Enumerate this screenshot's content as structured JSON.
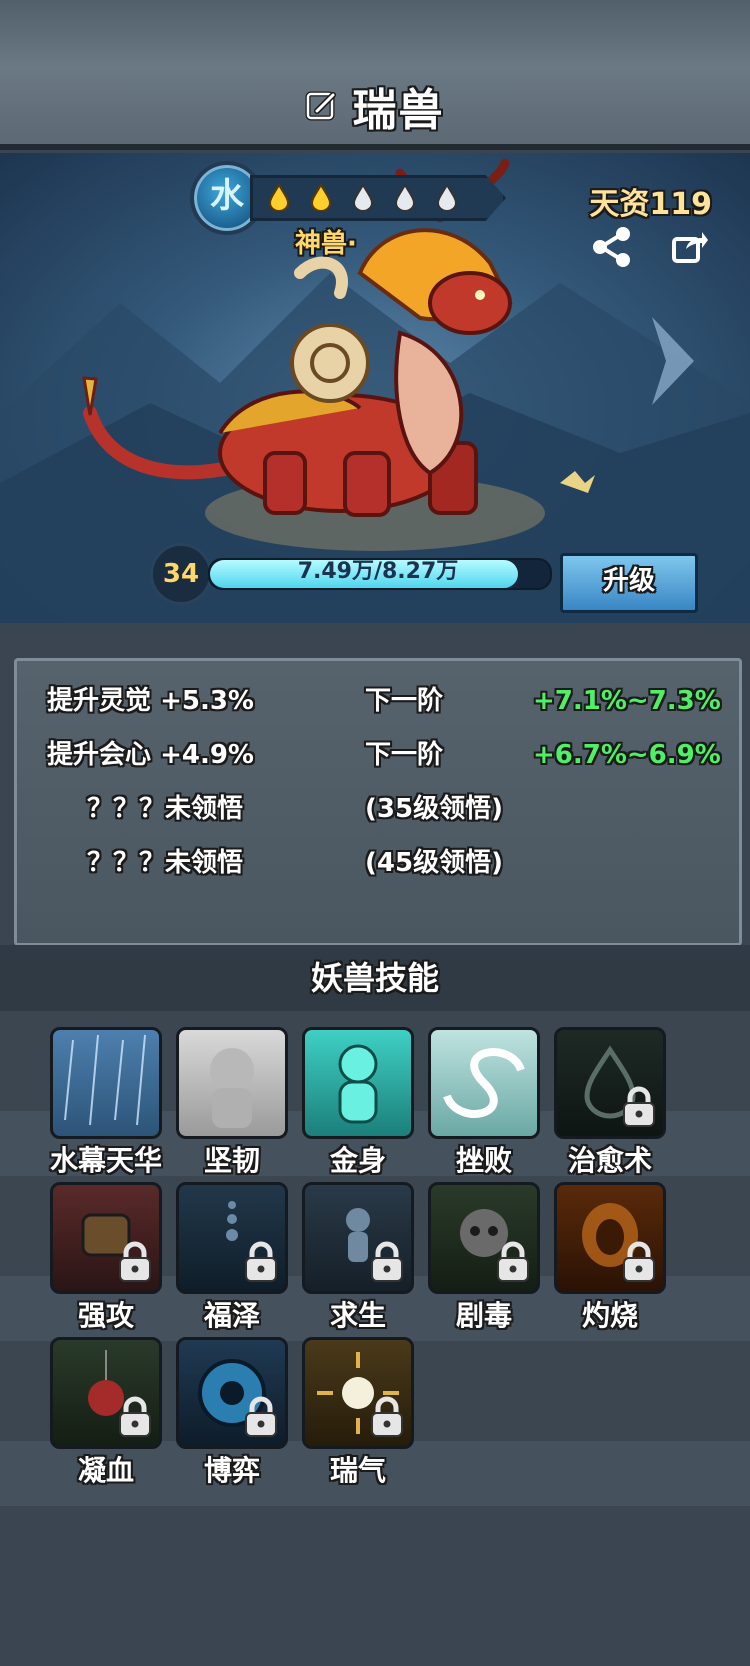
{
  "header": {
    "title": "瑞兽"
  },
  "pet": {
    "element": "水",
    "rarity_label": "神兽·",
    "aptitude": "天资119",
    "level": "34",
    "exp_text": "7.49万/8.27万",
    "exp_fraction": 0.905,
    "upgrade_label": "升级",
    "stars_filled": 2,
    "stars_total": 5
  },
  "stats": [
    {
      "name": "提升灵觉",
      "value": "+5.3%",
      "next_label": "下一阶",
      "next_value": "+7.1%~7.3%"
    },
    {
      "name": "提升会心",
      "value": "+4.9%",
      "next_label": "下一阶",
      "next_value": "+6.7%~6.9%"
    },
    {
      "name": "？？？未领悟",
      "value": "",
      "next_label": "(35级领悟)",
      "next_value": ""
    },
    {
      "name": "？？？未领悟",
      "value": "",
      "next_label": "(45级领悟)",
      "next_value": ""
    }
  ],
  "skills_title": "妖兽技能",
  "skills": [
    {
      "name": "水幕天华",
      "locked": false,
      "icon": "rain-icon"
    },
    {
      "name": "坚韧",
      "locked": false,
      "icon": "monk-icon"
    },
    {
      "name": "金身",
      "locked": false,
      "icon": "golden-body-icon"
    },
    {
      "name": "挫败",
      "locked": false,
      "icon": "whirl-icon"
    },
    {
      "name": "治愈术",
      "locked": true,
      "icon": "heal-drop-icon"
    },
    {
      "name": "强攻",
      "locked": true,
      "icon": "fist-icon"
    },
    {
      "name": "福泽",
      "locked": true,
      "icon": "bubbles-icon"
    },
    {
      "name": "求生",
      "locked": true,
      "icon": "survive-figure-icon"
    },
    {
      "name": "剧毒",
      "locked": true,
      "icon": "skull-icon"
    },
    {
      "name": "灼烧",
      "locked": true,
      "icon": "flame-icon"
    },
    {
      "name": "凝血",
      "locked": true,
      "icon": "blood-apple-icon"
    },
    {
      "name": "博弈",
      "locked": true,
      "icon": "eye-clock-icon"
    },
    {
      "name": "瑞气",
      "locked": true,
      "icon": "sun-burst-icon"
    }
  ],
  "colors": {
    "accent_green": "#4ef065",
    "gold": "#ffd76a",
    "exp_fill": "#4fd6ee"
  }
}
